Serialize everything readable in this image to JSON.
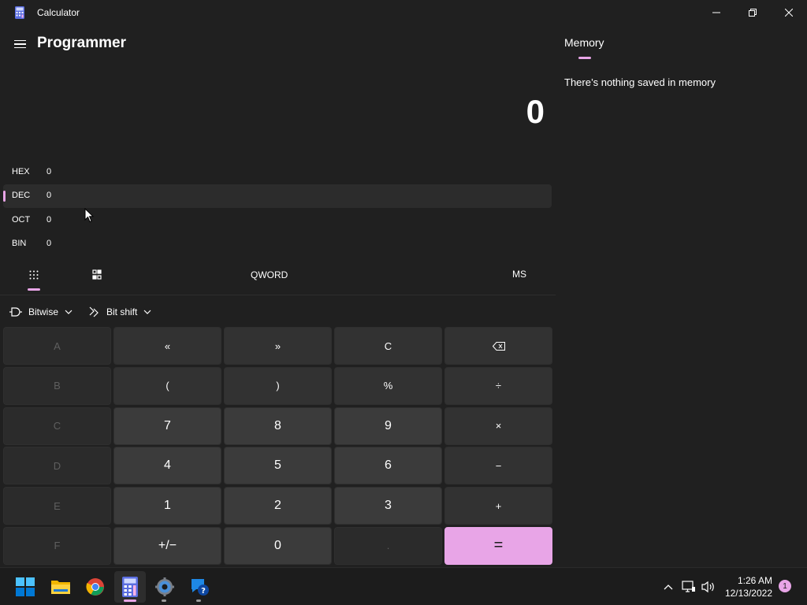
{
  "window": {
    "title": "Calculator"
  },
  "header": {
    "mode": "Programmer"
  },
  "display": {
    "value": "0"
  },
  "radix": [
    {
      "label": "HEX",
      "value": "0"
    },
    {
      "label": "DEC",
      "value": "0",
      "selected": true
    },
    {
      "label": "OCT",
      "value": "0"
    },
    {
      "label": "BIN",
      "value": "0"
    }
  ],
  "toolbar": {
    "word_size": "QWORD",
    "memory_store": "MS"
  },
  "dropdowns": {
    "bitwise": "Bitwise",
    "bitshift": "Bit shift"
  },
  "keys": {
    "a": "A",
    "lshift": "«",
    "rshift": "»",
    "clear": "C",
    "backspace": "backspace-icon",
    "b": "B",
    "lparen": "(",
    "rparen": ")",
    "mod": "%",
    "divide": "÷",
    "c": "C",
    "seven": "7",
    "eight": "8",
    "nine": "9",
    "multiply": "×",
    "d": "D",
    "four": "4",
    "five": "5",
    "six": "6",
    "minus": "−",
    "e": "E",
    "one": "1",
    "two": "2",
    "three": "3",
    "plus": "+",
    "f": "F",
    "negate": "+/−",
    "zero": "0",
    "decimal": ".",
    "equals": "="
  },
  "memory": {
    "title": "Memory",
    "empty_message": "There’s nothing saved in memory"
  },
  "taskbar": {
    "clock_time": "1:26 AM",
    "clock_date": "12/13/2022",
    "notification_count": "1"
  },
  "colors": {
    "accent": "#e8a5e7",
    "background": "#202020",
    "key": "#3b3b3b"
  }
}
